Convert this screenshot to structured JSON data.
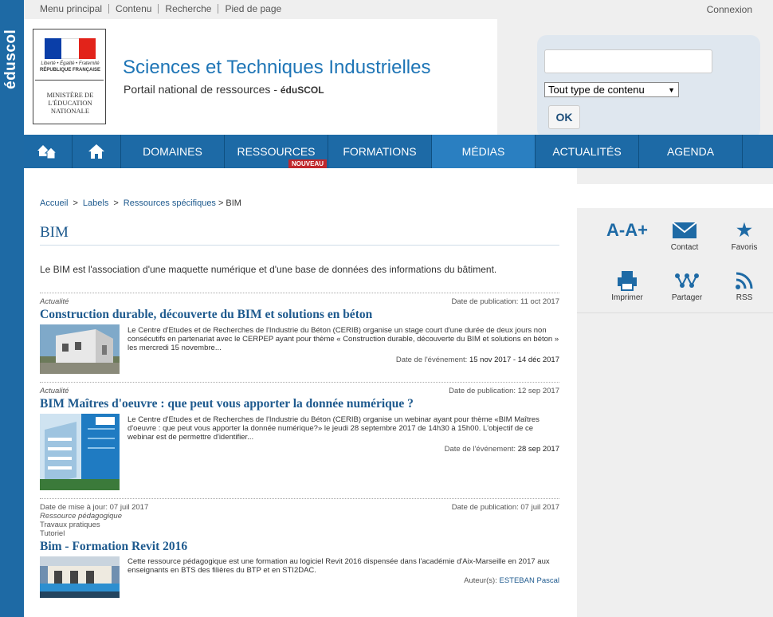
{
  "brand": "éduscol",
  "topbar": {
    "links": [
      "Menu principal",
      "Contenu",
      "Recherche",
      "Pied de page"
    ],
    "login": "Connexion"
  },
  "logo": {
    "motto": "Liberté • Égalité • Fraternité",
    "republic": "RÉPUBLIQUE FRANÇAISE",
    "ministry": "MINISTÈRE DE L'ÉDUCATION NATIONALE",
    "flag_colors": [
      "#0a3ea8",
      "#ffffff",
      "#e2231a"
    ]
  },
  "header": {
    "title": "Sciences et Techniques Industrielles",
    "subtitle": "Portail national de ressources - ",
    "subtitle_brand": "éduSCOL"
  },
  "search": {
    "placeholder": "",
    "select_value": "Tout type de contenu",
    "ok_label": "OK"
  },
  "nav": {
    "items": [
      {
        "label": "DOMAINES"
      },
      {
        "label": "RESSOURCES",
        "badge": "NOUVEAU"
      },
      {
        "label": "FORMATIONS"
      },
      {
        "label": "MÉDIAS"
      },
      {
        "label": "ACTUALITÉS"
      },
      {
        "label": "AGENDA"
      }
    ],
    "active": "MÉDIAS",
    "accent_color": "#1d6aa6"
  },
  "breadcrumb": {
    "items": [
      "Accueil",
      "Labels",
      "Ressources spécifiques"
    ],
    "current": "BIM"
  },
  "page": {
    "title": "BIM",
    "intro": "Le BIM est l'association d'une maquette numérique et d'une base de données des informations du bâtiment."
  },
  "tools": {
    "font_size": "A-A+",
    "contact": "Contact",
    "favoris": "Favoris",
    "imprimer": "Imprimer",
    "partager": "Partager",
    "rss": "RSS"
  },
  "articles": [
    {
      "category": "Actualité",
      "pub_date": "Date de publication: 11 oct 2017",
      "title": "Construction durable, découverte du BIM et solutions en béton",
      "description": "Le Centre d'Etudes et de Recherches de l'Industrie du Béton (CERIB) organise un stage court d'une durée de deux jours non consécutifs en partenariat avec le CERPEP ayant pour thème « Construction durable, découverte du BIM et solutions en béton » les mercredi 15 novembre...",
      "event_label": "Date de l'événement: ",
      "event_date": "15 nov 2017 - 14 déc 2017"
    },
    {
      "category": "Actualité",
      "pub_date": "Date de publication: 12 sep 2017",
      "title": "BIM Maîtres d'oeuvre : que peut vous apporter la donnée numérique ?",
      "description": "Le Centre d'Etudes et de Recherches de l'Industrie du Béton (CERIB) organise un webinar ayant pour thème «BIM Maîtres d'oeuvre : que peut vous apporter la donnée numérique?» le jeudi 28 septembre 2017 de 14h30 à 15h00. L'objectif de ce webinar est de permettre d'identifier...",
      "event_label": "Date de l'événement: ",
      "event_date": "28 sep 2017"
    },
    {
      "updated": "Date de mise à jour: 07 juil 2017",
      "category": "Ressource pédagogique",
      "tags": [
        "Travaux pratiques",
        "Tutoriel"
      ],
      "pub_date": "Date de publication: 07 juil 2017",
      "title": "Bim - Formation Revit 2016",
      "description": "Cette ressource pédagogique est une formation au logiciel Revit 2016 dispensée dans l'académie d'Aix-Marseille en 2017 aux enseignants en BTS des filières du BTP et en STI2DAC.",
      "author_label": "Auteur(s): ",
      "author": "ESTEBAN Pascal"
    }
  ]
}
